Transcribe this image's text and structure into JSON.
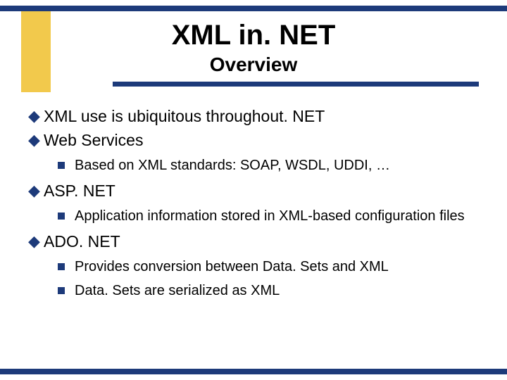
{
  "title": "XML in. NET",
  "subtitle": "Overview",
  "items": [
    {
      "level": 1,
      "text": "XML use is ubiquitous throughout. NET"
    },
    {
      "level": 1,
      "text": "Web Services"
    },
    {
      "level": 2,
      "text": "Based on XML standards: SOAP, WSDL, UDDI, …"
    },
    {
      "level": 1,
      "text": "ASP. NET"
    },
    {
      "level": 2,
      "text": "Application information stored in XML-based configuration files"
    },
    {
      "level": 1,
      "text": "ADO. NET"
    },
    {
      "level": 2,
      "text": "Provides conversion between Data. Sets and XML"
    },
    {
      "level": 2,
      "text": "Data. Sets are serialized as XML"
    }
  ]
}
